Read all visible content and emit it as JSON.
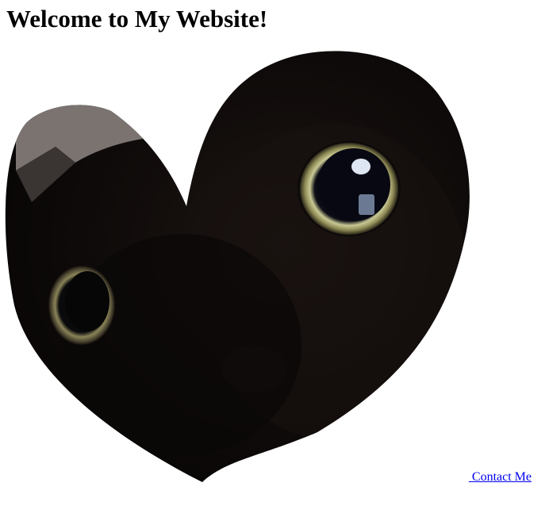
{
  "header": {
    "title": "Welcome to My Website!"
  },
  "hero_image": {
    "icon": "heart-shaped-cat-photo"
  },
  "footer": {
    "contact_link_label": " Contact Me",
    "link_color": "#0000ee"
  }
}
